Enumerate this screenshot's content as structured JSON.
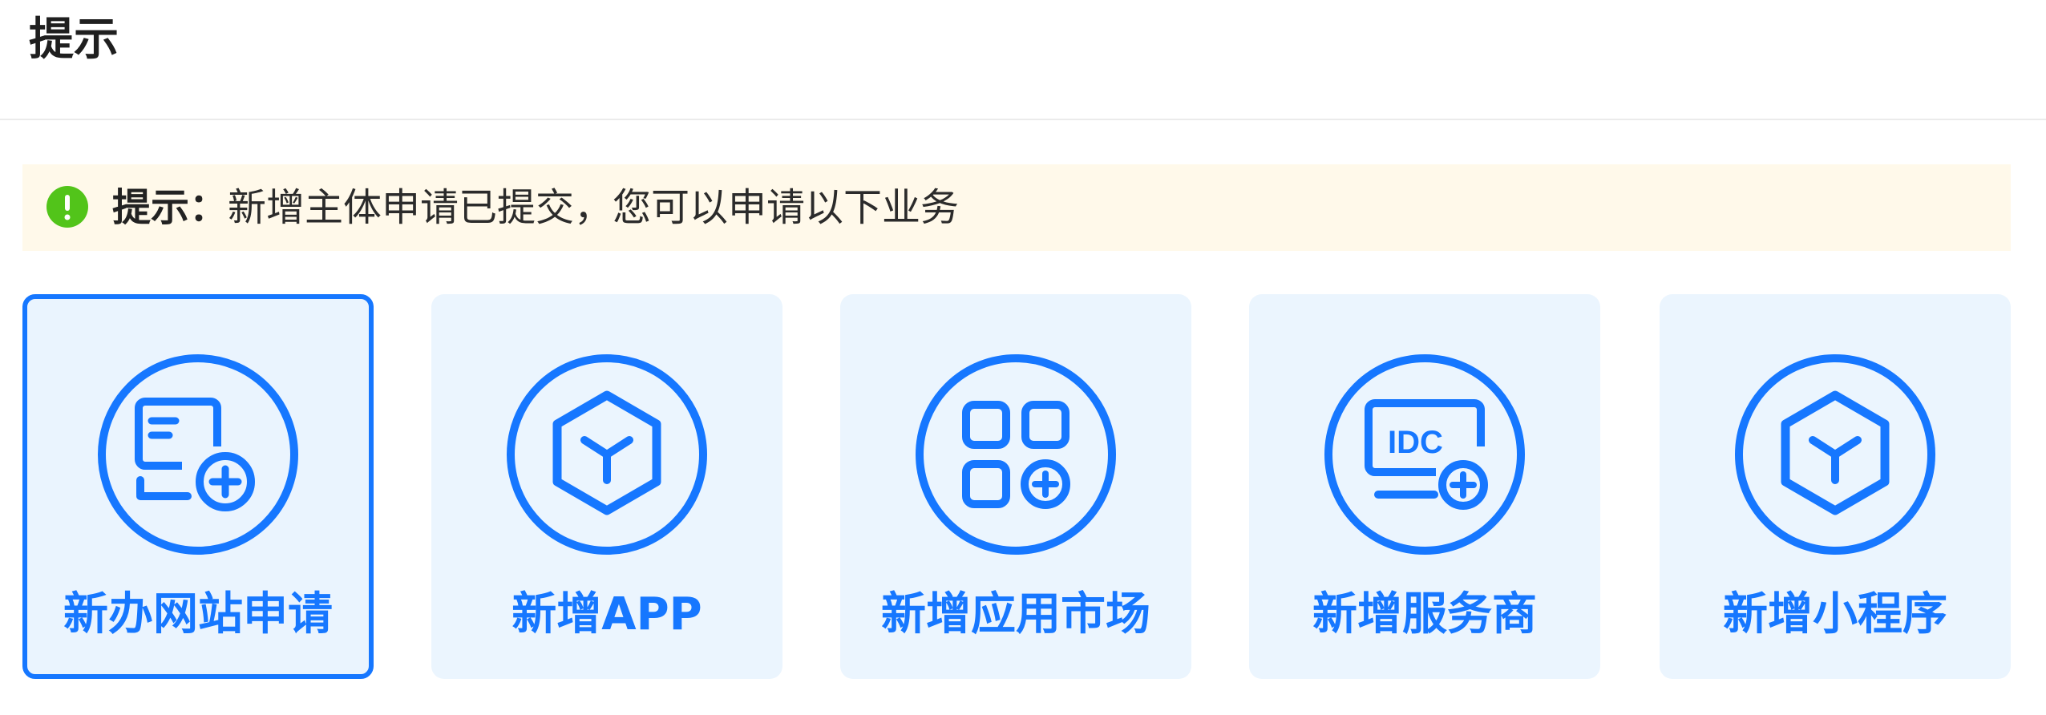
{
  "header": {
    "title": "提示"
  },
  "notice": {
    "icon": "exclamation-circle-icon",
    "label": "提示：",
    "message": "新增主体申请已提交，您可以申请以下业务"
  },
  "cards": [
    {
      "label": "新办网站申请",
      "icon": "website-add-icon",
      "selected": true
    },
    {
      "label": "新增APP",
      "icon": "cube-icon",
      "selected": false
    },
    {
      "label": "新增应用市场",
      "icon": "app-grid-add-icon",
      "selected": false
    },
    {
      "label": "新增服务商",
      "icon": "idc-monitor-add-icon",
      "selected": false
    },
    {
      "label": "新增小程序",
      "icon": "cube-icon",
      "selected": false
    }
  ],
  "colors": {
    "primary": "#1677ff",
    "card_bg": "#ebf5fe",
    "notice_bg": "#fff9ea",
    "success_green": "#52c41a"
  }
}
